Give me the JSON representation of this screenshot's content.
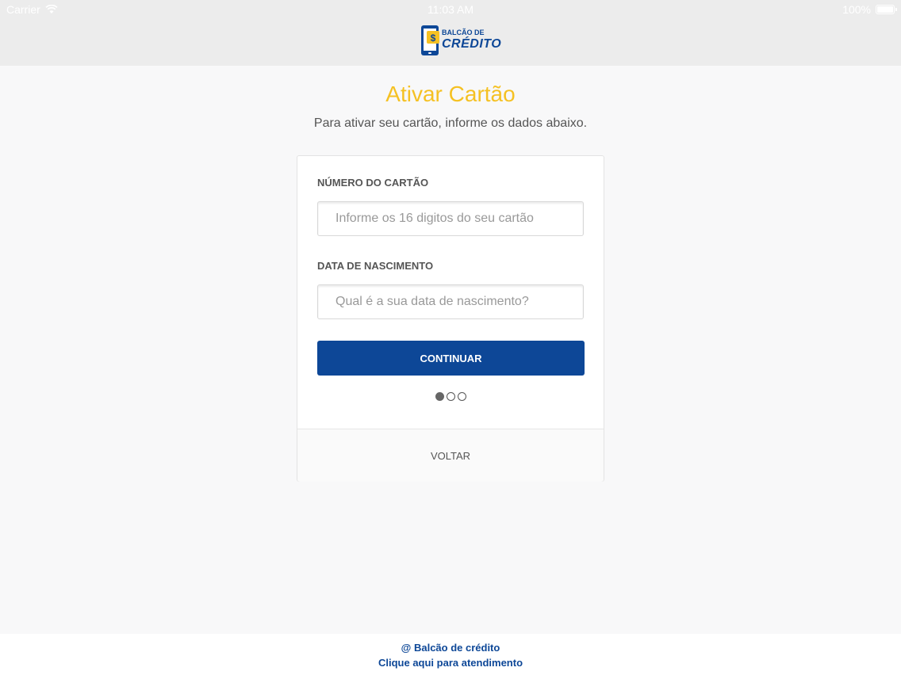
{
  "status_bar": {
    "carrier": "Carrier",
    "time": "11:03 AM",
    "battery": "100%"
  },
  "logo": {
    "line1": "BALCÃO DE",
    "line2": "CRÉDITO",
    "colors": {
      "blue": "#0d4797",
      "yellow": "#f5c123"
    }
  },
  "page": {
    "title": "Ativar Cartão",
    "subtitle": "Para ativar seu cartão, informe os dados abaixo."
  },
  "form": {
    "card_number_label": "NÚMERO DO CARTÃO",
    "card_number_placeholder": "Informe os 16 digitos do seu cartão",
    "card_number_value": "",
    "birth_date_label": "DATA DE NASCIMENTO",
    "birth_date_placeholder": "Qual é a sua data de nascimento?",
    "birth_date_value": "",
    "continue_label": "CONTINUAR",
    "back_label": "VOLTAR"
  },
  "progress": {
    "total_steps": 3,
    "current_step": 1
  },
  "footer": {
    "copyright": "@ Balcão de crédito",
    "support_link": "Clique aqui para atendimento"
  },
  "colors": {
    "accent_yellow": "#f5c123",
    "primary_blue": "#0d4797",
    "header_bg": "#ececec",
    "page_bg": "#f8f8f9"
  }
}
